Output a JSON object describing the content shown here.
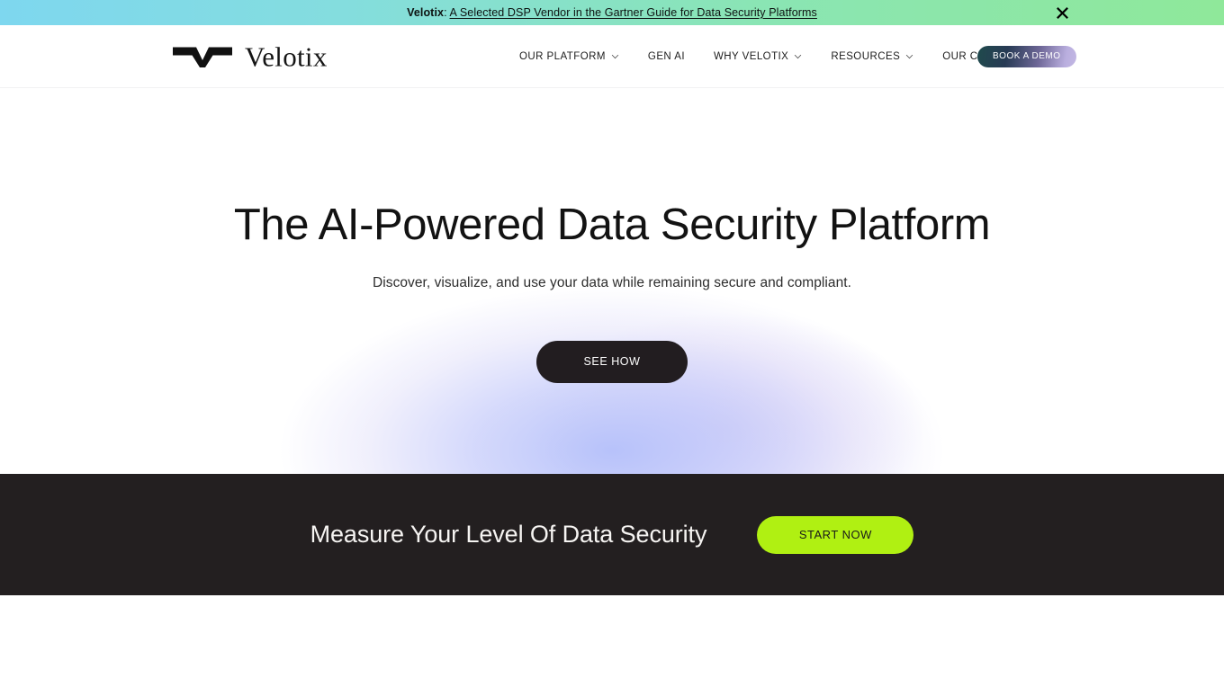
{
  "banner": {
    "brand": "Velotix",
    "separator": ": ",
    "link_text": "A Selected DSP Vendor in the Gartner Guide for Data Security Platforms",
    "close_icon": "close-icon",
    "gradient_start": "#7ed7ef",
    "gradient_end": "#8fe89a"
  },
  "header": {
    "logo": {
      "mark_icon": "velotix-chevron-mark-icon",
      "wordmark": "Velotix"
    },
    "nav": [
      {
        "label": "OUR PLATFORM",
        "has_dropdown": true
      },
      {
        "label": "GEN AI",
        "has_dropdown": false
      },
      {
        "label": "WHY VELOTIX",
        "has_dropdown": true
      },
      {
        "label": "RESOURCES",
        "has_dropdown": true
      },
      {
        "label": "OUR COMPANY",
        "has_dropdown": true
      }
    ],
    "cta": {
      "label": "BOOK A DEMO",
      "gradient_start": "#1f4a4c",
      "gradient_end": "#c3b8e4"
    }
  },
  "hero": {
    "title": "The AI-Powered Data Security Platform",
    "subtitle": "Discover, visualize, and use your data while remaining secure and compliant.",
    "cta_label": "SEE HOW",
    "cta_background": "#221d20",
    "glow_color": "#c2cbf7"
  },
  "measure_band": {
    "title": "Measure Your Level Of Data Security",
    "cta_label": "START NOW",
    "background": "#231f20",
    "cta_color": "#b0f012"
  }
}
